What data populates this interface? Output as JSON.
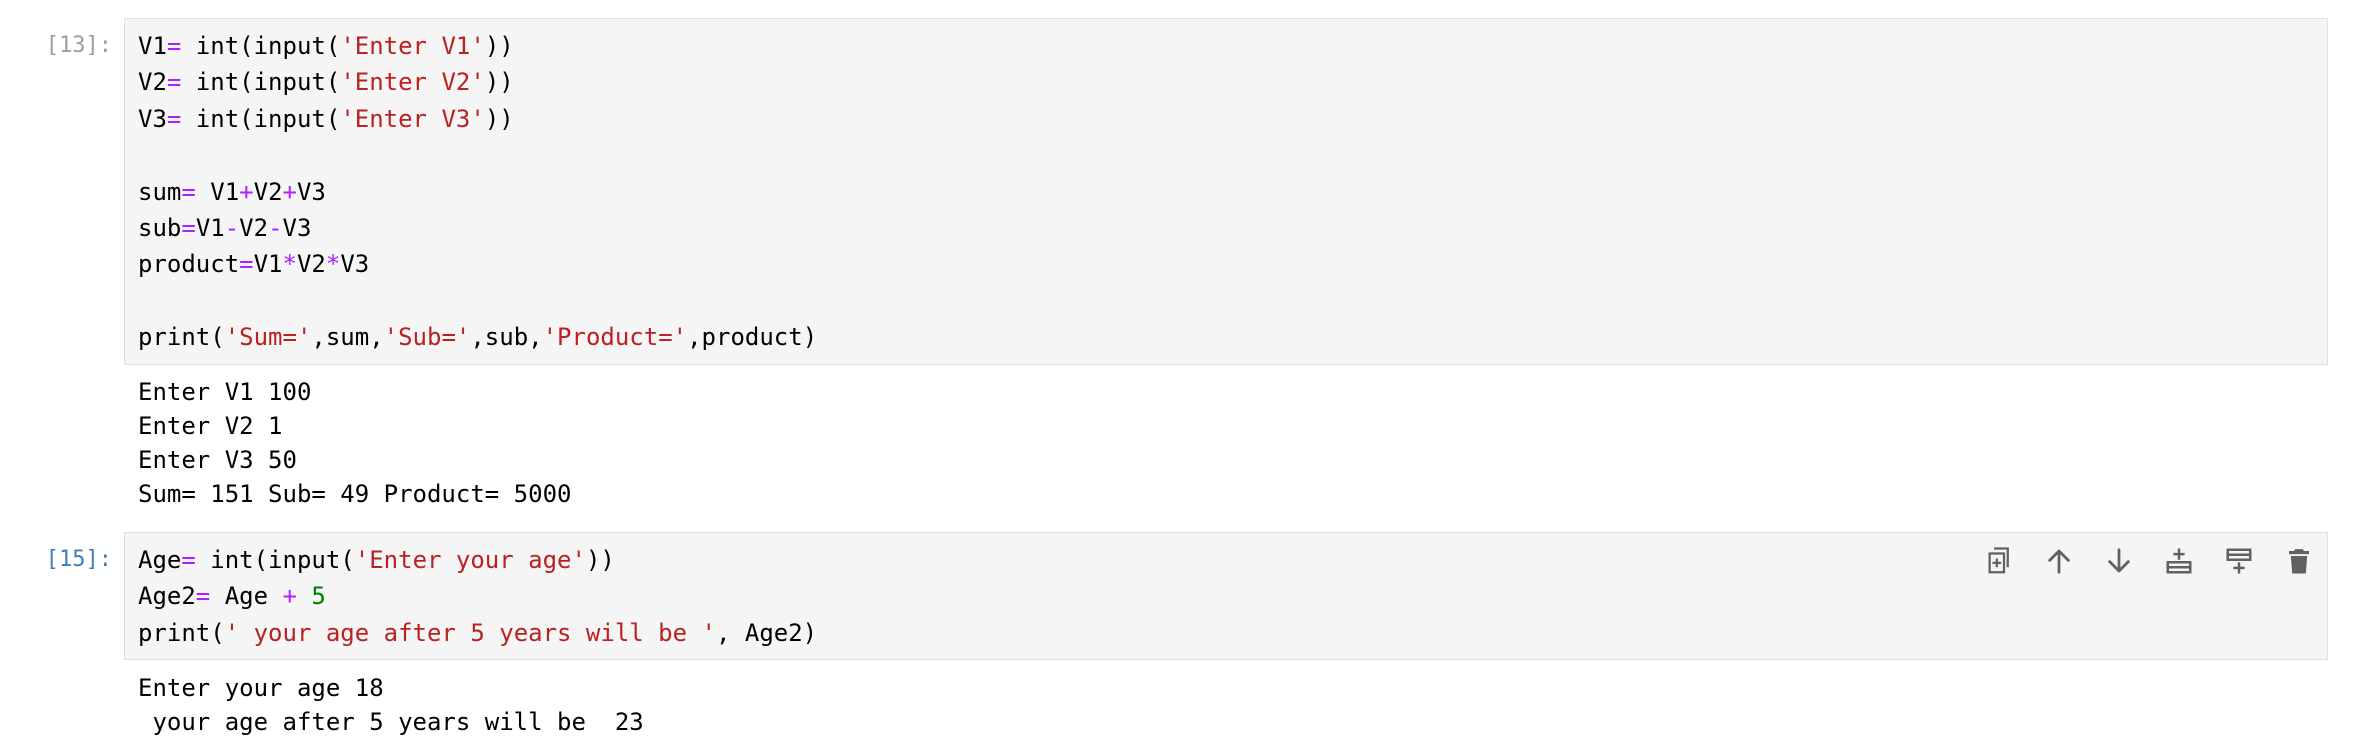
{
  "cells": [
    {
      "prompt": "[13]:",
      "active": false,
      "code_lines": [
        [
          {
            "t": "V1",
            "k": "name"
          },
          {
            "t": "=",
            "k": "op"
          },
          {
            "t": " int(input(",
            "k": "name"
          },
          {
            "t": "'Enter V1'",
            "k": "str"
          },
          {
            "t": "))",
            "k": "name"
          }
        ],
        [
          {
            "t": "V2",
            "k": "name"
          },
          {
            "t": "=",
            "k": "op"
          },
          {
            "t": " int(input(",
            "k": "name"
          },
          {
            "t": "'Enter V2'",
            "k": "str"
          },
          {
            "t": "))",
            "k": "name"
          }
        ],
        [
          {
            "t": "V3",
            "k": "name"
          },
          {
            "t": "=",
            "k": "op"
          },
          {
            "t": " int(input(",
            "k": "name"
          },
          {
            "t": "'Enter V3'",
            "k": "str"
          },
          {
            "t": "))",
            "k": "name"
          }
        ],
        [],
        [
          {
            "t": "sum",
            "k": "name"
          },
          {
            "t": "=",
            "k": "op"
          },
          {
            "t": " V1",
            "k": "name"
          },
          {
            "t": "+",
            "k": "op"
          },
          {
            "t": "V2",
            "k": "name"
          },
          {
            "t": "+",
            "k": "op"
          },
          {
            "t": "V3",
            "k": "name"
          }
        ],
        [
          {
            "t": "sub",
            "k": "name"
          },
          {
            "t": "=",
            "k": "op"
          },
          {
            "t": "V1",
            "k": "name"
          },
          {
            "t": "-",
            "k": "op"
          },
          {
            "t": "V2",
            "k": "name"
          },
          {
            "t": "-",
            "k": "op"
          },
          {
            "t": "V3",
            "k": "name"
          }
        ],
        [
          {
            "t": "product",
            "k": "name"
          },
          {
            "t": "=",
            "k": "op"
          },
          {
            "t": "V1",
            "k": "name"
          },
          {
            "t": "*",
            "k": "op"
          },
          {
            "t": "V2",
            "k": "name"
          },
          {
            "t": "*",
            "k": "op"
          },
          {
            "t": "V3",
            "k": "name"
          }
        ],
        [],
        [
          {
            "t": "print(",
            "k": "name"
          },
          {
            "t": "'Sum='",
            "k": "str"
          },
          {
            "t": ",sum,",
            "k": "name"
          },
          {
            "t": "'Sub='",
            "k": "str"
          },
          {
            "t": ",sub,",
            "k": "name"
          },
          {
            "t": "'Product='",
            "k": "str"
          },
          {
            "t": ",product)",
            "k": "name"
          }
        ]
      ],
      "output_lines": [
        "Enter V1 100",
        "Enter V2 1",
        "Enter V3 50",
        "Sum= 151 Sub= 49 Product= 5000"
      ]
    },
    {
      "prompt": "[15]:",
      "active": true,
      "code_lines": [
        [
          {
            "t": "Age",
            "k": "name"
          },
          {
            "t": "=",
            "k": "op"
          },
          {
            "t": " int(input(",
            "k": "name"
          },
          {
            "t": "'Enter your age'",
            "k": "str"
          },
          {
            "t": "))",
            "k": "name"
          }
        ],
        [
          {
            "t": "Age2",
            "k": "name"
          },
          {
            "t": "=",
            "k": "op"
          },
          {
            "t": " Age ",
            "k": "name"
          },
          {
            "t": "+",
            "k": "op"
          },
          {
            "t": " ",
            "k": "name"
          },
          {
            "t": "5",
            "k": "num"
          }
        ],
        [
          {
            "t": "print(",
            "k": "name"
          },
          {
            "t": "' your age after 5 years will be '",
            "k": "str"
          },
          {
            "t": ", Age2)",
            "k": "name"
          }
        ]
      ],
      "output_lines": [
        "Enter your age 18",
        " your age after 5 years will be  23"
      ]
    }
  ],
  "cell_toolbar": {
    "buttons": [
      {
        "name": "duplicate-cell",
        "icon": "duplicate-icon"
      },
      {
        "name": "move-cell-up",
        "icon": "arrow-up-icon"
      },
      {
        "name": "move-cell-down",
        "icon": "arrow-down-icon"
      },
      {
        "name": "insert-cell-above",
        "icon": "insert-above-icon"
      },
      {
        "name": "insert-cell-below",
        "icon": "insert-below-icon"
      },
      {
        "name": "delete-cell",
        "icon": "trash-icon"
      }
    ],
    "icon_color": "#616161"
  },
  "colors": {
    "code_background": "#f5f5f5",
    "code_border": "#e0e0e0",
    "operator": "#aa22ff",
    "string": "#ba2121",
    "number": "#008000",
    "prompt_inactive": "#9e9e9e",
    "prompt_active": "#3f7fb5"
  }
}
